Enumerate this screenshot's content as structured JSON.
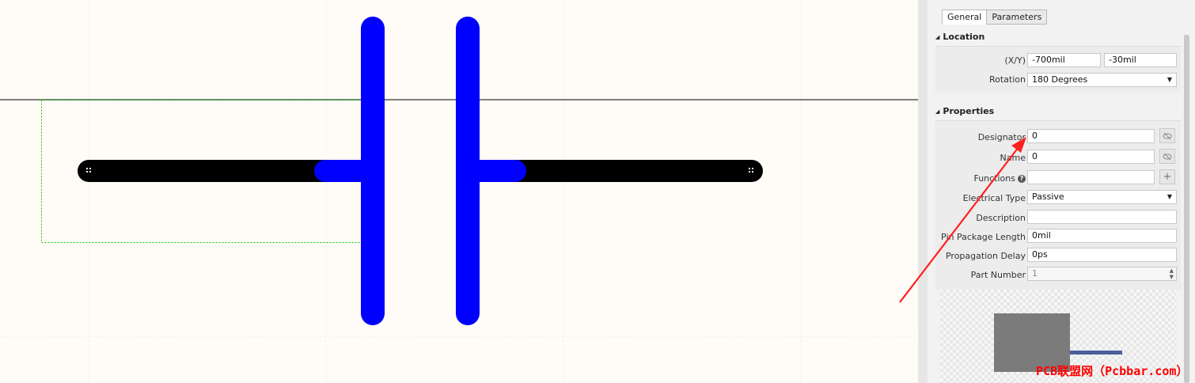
{
  "colors": {
    "canvas_bg": "#fffcf7",
    "capacitor_plate": "#0000ff",
    "pin_line": "#000000",
    "selection_box": "#00cc00",
    "annotation_arrow": "#ff2020",
    "watermark": "#ff0000"
  },
  "panel": {
    "tabs": [
      "General",
      "Parameters"
    ],
    "active_tab": "General",
    "location": {
      "title": "Location",
      "xy_label": "(X/Y)",
      "x_value": "-700mil",
      "y_value": "-30mil",
      "rotation_label": "Rotation",
      "rotation_value": "180 Degrees"
    },
    "properties": {
      "title": "Properties",
      "designator_label": "Designator",
      "designator_value": "0",
      "name_label": "Name",
      "name_value": "0",
      "functions_label": "Functions",
      "functions_value": "",
      "electrical_type_label": "Electrical Type",
      "electrical_type_value": "Passive",
      "description_label": "Description",
      "description_value": "",
      "pin_package_length_label": "Pin Package Length",
      "pin_package_length_value": "0mil",
      "propagation_delay_label": "Propagation Delay",
      "propagation_delay_value": "0ps",
      "part_number_label": "Part Number",
      "part_number_value": "1"
    }
  },
  "icons": {
    "visibility_toggle": "eye-slash-icon",
    "add": "plus-icon",
    "help": "question-icon",
    "dropdown": "chevron-down-icon",
    "collapse": "triangle-collapse-icon"
  },
  "watermark_text": "PCB联盟网（Pcbbar.com）"
}
